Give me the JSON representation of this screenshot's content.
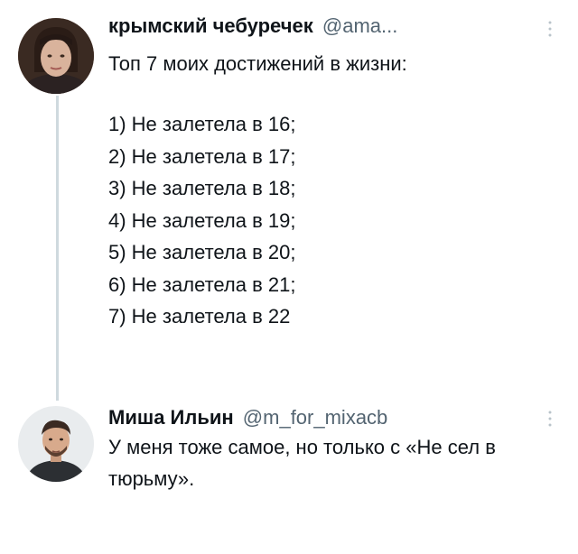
{
  "tweets": [
    {
      "author_name": "крымский чебуречек",
      "handle": "@ama...",
      "text": "Топ 7 моих достижений в жизни:",
      "list": [
        "1) Не залетела в 16;",
        "2) Не залетела в 17;",
        "3) Не залетела в 18;",
        "4) Не залетела в 19;",
        "5) Не залетела в 20;",
        "6) Не залетела в 21;",
        "7) Не залетела в 22"
      ],
      "more_icon": "more-vertical-icon"
    },
    {
      "author_name": "Миша Ильин",
      "handle": "@m_for_mixacb",
      "text": "У меня тоже самое, но только с «Не сел в тюрьму».",
      "more_icon": "more-vertical-icon"
    }
  ],
  "colors": {
    "text": "#0f1419",
    "secondary": "#536471",
    "thread_line": "#cfd9de"
  }
}
